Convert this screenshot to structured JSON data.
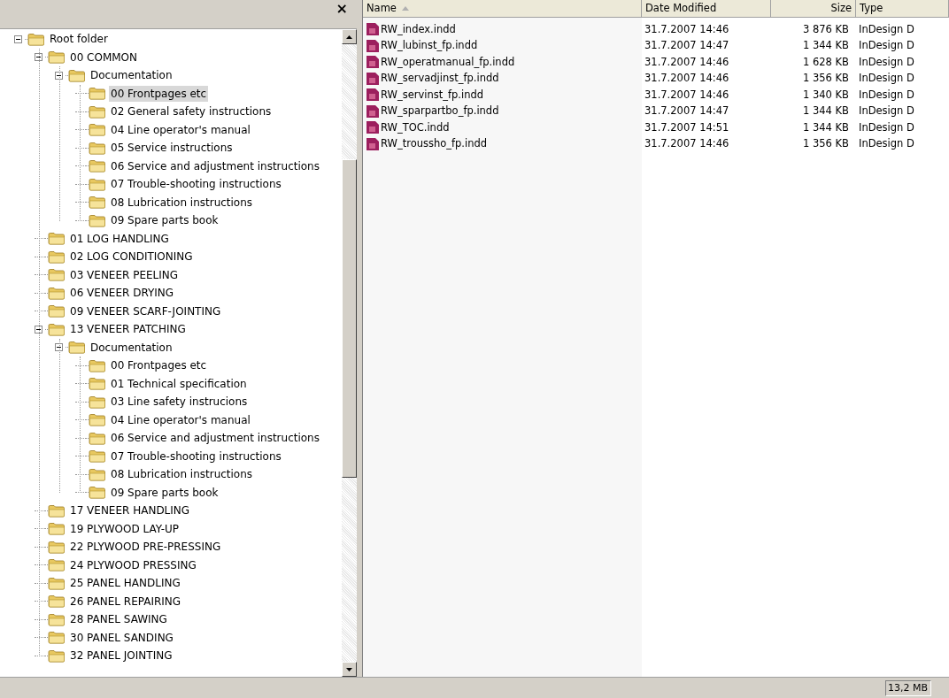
{
  "tree_pane": {
    "close_button": "×",
    "items": [
      {
        "label": "Root folder",
        "expanded": true,
        "selected": false,
        "children": [
          {
            "label": "00 COMMON",
            "expanded": true,
            "selected": false,
            "children": [
              {
                "label": "Documentation",
                "expanded": true,
                "selected": false,
                "children": [
                  {
                    "label": "00 Frontpages etc",
                    "selected": true
                  },
                  {
                    "label": "02 General safety instructions",
                    "selected": false
                  },
                  {
                    "label": "04 Line operator's manual",
                    "selected": false
                  },
                  {
                    "label": "05 Service instructions",
                    "selected": false
                  },
                  {
                    "label": "06 Service and adjustment instructions",
                    "selected": false
                  },
                  {
                    "label": "07 Trouble-shooting instructions",
                    "selected": false
                  },
                  {
                    "label": "08 Lubrication instructions",
                    "selected": false
                  },
                  {
                    "label": "09 Spare parts book",
                    "selected": false
                  }
                ]
              }
            ]
          },
          {
            "label": "01 LOG HANDLING",
            "selected": false
          },
          {
            "label": "02 LOG CONDITIONING",
            "selected": false
          },
          {
            "label": "03 VENEER PEELING",
            "selected": false
          },
          {
            "label": "06 VENEER DRYING",
            "selected": false
          },
          {
            "label": "09 VENEER SCARF-JOINTING",
            "selected": false
          },
          {
            "label": "13 VENEER PATCHING",
            "expanded": true,
            "selected": false,
            "children": [
              {
                "label": "Documentation",
                "expanded": true,
                "selected": false,
                "children": [
                  {
                    "label": "00 Frontpages etc",
                    "selected": false
                  },
                  {
                    "label": "01 Technical specification",
                    "selected": false
                  },
                  {
                    "label": "03 Line safety instrucions",
                    "selected": false
                  },
                  {
                    "label": "04 Line operator's manual",
                    "selected": false
                  },
                  {
                    "label": "06 Service and adjustment instructions",
                    "selected": false
                  },
                  {
                    "label": "07 Trouble-shooting instructions",
                    "selected": false
                  },
                  {
                    "label": "08 Lubrication instructions",
                    "selected": false
                  },
                  {
                    "label": "09 Spare parts book",
                    "selected": false
                  }
                ]
              }
            ]
          },
          {
            "label": "17 VENEER HANDLING",
            "selected": false
          },
          {
            "label": "19 PLYWOOD LAY-UP",
            "selected": false
          },
          {
            "label": "22 PLYWOOD PRE-PRESSING",
            "selected": false
          },
          {
            "label": "24 PLYWOOD PRESSING",
            "selected": false
          },
          {
            "label": "25 PANEL HANDLING",
            "selected": false
          },
          {
            "label": "26 PANEL REPAIRING",
            "selected": false
          },
          {
            "label": "28 PANEL SAWING",
            "selected": false
          },
          {
            "label": "30 PANEL SANDING",
            "selected": false
          },
          {
            "label": "32 PANEL JOINTING",
            "selected": false
          }
        ]
      }
    ]
  },
  "file_list": {
    "columns": [
      {
        "label": "Name",
        "sorted": true
      },
      {
        "label": "Date Modified",
        "sorted": false
      },
      {
        "label": "Size",
        "sorted": false
      },
      {
        "label": "Type",
        "sorted": false
      }
    ],
    "rows": [
      [
        "RW_index.indd",
        "31.7.2007 14:46",
        "3 876 KB",
        "InDesign D"
      ],
      [
        "RW_lubinst_fp.indd",
        "31.7.2007 14:47",
        "1 344 KB",
        "InDesign D"
      ],
      [
        "RW_operatmanual_fp.indd",
        "31.7.2007 14:46",
        "1 628 KB",
        "InDesign D"
      ],
      [
        "RW_servadjinst_fp.indd",
        "31.7.2007 14:46",
        "1 356 KB",
        "InDesign D"
      ],
      [
        "RW_servinst_fp.indd",
        "31.7.2007 14:46",
        "1 340 KB",
        "InDesign D"
      ],
      [
        "RW_sparpartbo_fp.indd",
        "31.7.2007 14:47",
        "1 344 KB",
        "InDesign D"
      ],
      [
        "RW_TOC.indd",
        "31.7.2007 14:51",
        "1 344 KB",
        "InDesign D"
      ],
      [
        "RW_troussho_fp.indd",
        "31.7.2007 14:46",
        "1 356 KB",
        "InDesign D"
      ]
    ]
  },
  "status_bar": {
    "size": "13,2 MB"
  }
}
